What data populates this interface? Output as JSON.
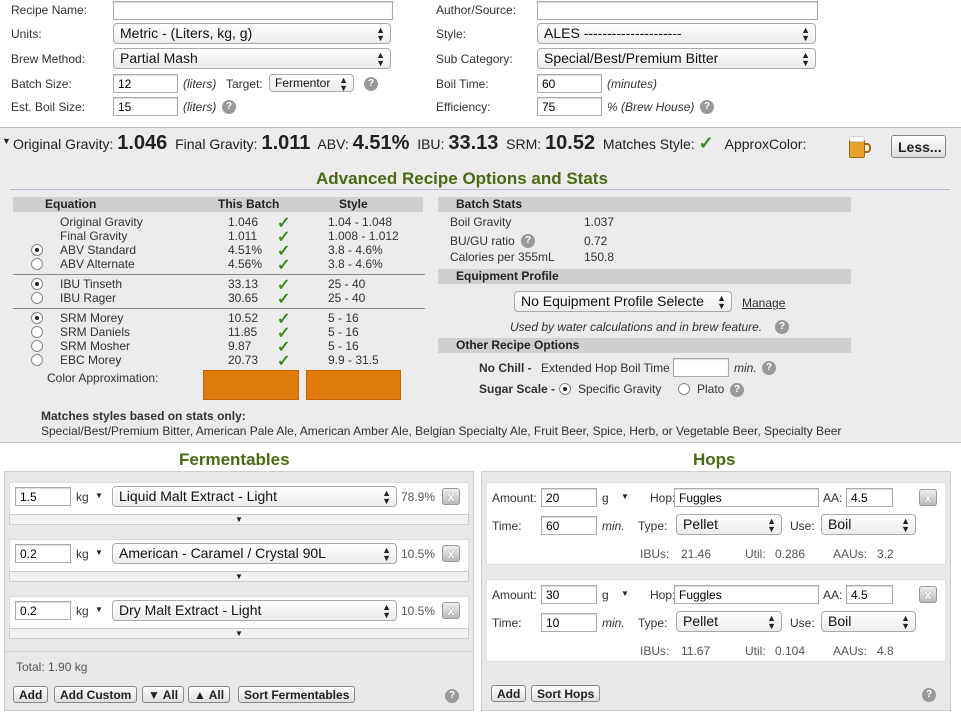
{
  "top": {
    "recipe_name_label": "Recipe Name:",
    "recipe_name_value": "",
    "author_label": "Author/Source:",
    "author_value": "",
    "units_label": "Units:",
    "units_value": "Metric - (Liters, kg, g)",
    "style_label": "Style:",
    "style_value": "ALES ---------------------",
    "brew_method_label": "Brew Method:",
    "brew_method_value": "Partial Mash",
    "subcat_label": "Sub Category:",
    "subcat_value": "Special/Best/Premium Bitter",
    "batch_size_label": "Batch Size:",
    "batch_size_value": "12",
    "batch_size_unit": "(liters)",
    "target_label": "Target:",
    "target_value": "Fermentor",
    "boil_time_label": "Boil Time:",
    "boil_time_value": "60",
    "boil_time_unit": "(minutes)",
    "est_boil_label": "Est. Boil Size:",
    "est_boil_value": "15",
    "est_boil_unit": "(liters)",
    "efficiency_label": "Efficiency:",
    "efficiency_value": "75",
    "efficiency_unit": "% (Brew House)"
  },
  "summary": {
    "og_label": "Original Gravity:",
    "og_value": "1.046",
    "fg_label": "Final Gravity:",
    "fg_value": "1.011",
    "abv_label": "ABV:",
    "abv_value": "4.51%",
    "ibu_label": "IBU:",
    "ibu_value": "33.13",
    "srm_label": "SRM:",
    "srm_value": "10.52",
    "matches_label": "Matches Style:",
    "approx_label": "ApproxColor:",
    "less_button": "Less..."
  },
  "advanced": {
    "title": "Advanced Recipe Options and Stats",
    "col_equation": "Equation",
    "col_batch": "This Batch",
    "col_style": "Style",
    "rows": [
      {
        "name": "Original Gravity",
        "batch": "1.046",
        "style": "1.04 - 1.048"
      },
      {
        "name": "Final Gravity",
        "batch": "1.011",
        "style": "1.008 - 1.012"
      },
      {
        "name": "ABV Standard",
        "batch": "4.51%",
        "style": "3.8 - 4.6%"
      },
      {
        "name": "ABV Alternate",
        "batch": "4.56%",
        "style": "3.8 - 4.6%"
      },
      {
        "name": "IBU Tinseth",
        "batch": "33.13",
        "style": "25 - 40"
      },
      {
        "name": "IBU Rager",
        "batch": "30.65",
        "style": "25 - 40"
      },
      {
        "name": "SRM Morey",
        "batch": "10.52",
        "style": "5 - 16"
      },
      {
        "name": "SRM Daniels",
        "batch": "11.85",
        "style": "5 - 16"
      },
      {
        "name": "SRM Mosher",
        "batch": "9.87",
        "style": "5 - 16"
      },
      {
        "name": "EBC Morey",
        "batch": "20.73",
        "style": "9.9 - 31.5"
      }
    ],
    "color_approx_label": "Color Approximation:",
    "swatch_color": "#e07a0b",
    "batch_stats_header": "Batch Stats",
    "boil_gravity_label": "Boil Gravity",
    "boil_gravity_value": "1.037",
    "bugu_label": "BU/GU ratio",
    "bugu_value": "0.72",
    "calories_label": "Calories per 355mL",
    "calories_value": "150.8",
    "equipment_header": "Equipment Profile",
    "equipment_value": "No Equipment Profile Selecte",
    "manage_link": "Manage",
    "equipment_note": "Used by water calculations and in brew feature.",
    "other_header": "Other Recipe Options",
    "no_chill_label": "No Chill -",
    "extended_hop_label": "Extended Hop Boil Time",
    "extended_hop_value": "",
    "min_unit": "min.",
    "sugar_scale_label": "Sugar Scale -",
    "sg_option": "Specific Gravity",
    "plato_option": "Plato",
    "matches_stats_label": "Matches styles based on stats only:",
    "matches_list": "Special/Best/Premium Bitter, American Pale Ale, American Amber Ale, Belgian Specialty Ale, Fruit Beer, Spice, Herb, or Vegetable Beer, Specialty Beer"
  },
  "fermentables": {
    "title": "Fermentables",
    "items": [
      {
        "amount": "1.5",
        "unit": "kg",
        "name": "Liquid Malt Extract - Light",
        "pct": "78.9%"
      },
      {
        "amount": "0.2",
        "unit": "kg",
        "name": "American - Caramel / Crystal 90L",
        "pct": "10.5%"
      },
      {
        "amount": "0.2",
        "unit": "kg",
        "name": "Dry Malt Extract - Light",
        "pct": "10.5%"
      }
    ],
    "total": "Total: 1.90 kg",
    "add": "Add",
    "add_custom": "Add Custom",
    "collapse_all": "▼ All",
    "expand_all": "▲ All",
    "sort": "Sort Fermentables"
  },
  "hops": {
    "title": "Hops",
    "amount_label": "Amount:",
    "hop_label": "Hop:",
    "aa_label": "AA:",
    "time_label": "Time:",
    "type_label": "Type:",
    "use_label": "Use:",
    "ibus_label": "IBUs:",
    "util_label": "Util:",
    "aaus_label": "AAUs:",
    "items": [
      {
        "amount": "20",
        "unit": "g",
        "name": "Fuggles",
        "aa": "4.5",
        "time": "60",
        "time_unit": "min.",
        "type": "Pellet",
        "use": "Boil",
        "ibus": "21.46",
        "util": "0.286",
        "aaus": "3.2"
      },
      {
        "amount": "30",
        "unit": "g",
        "name": "Fuggles",
        "aa": "4.5",
        "time": "10",
        "time_unit": "min.",
        "type": "Pellet",
        "use": "Boil",
        "ibus": "11.67",
        "util": "0.104",
        "aaus": "4.8"
      }
    ],
    "add": "Add",
    "sort": "Sort Hops"
  }
}
